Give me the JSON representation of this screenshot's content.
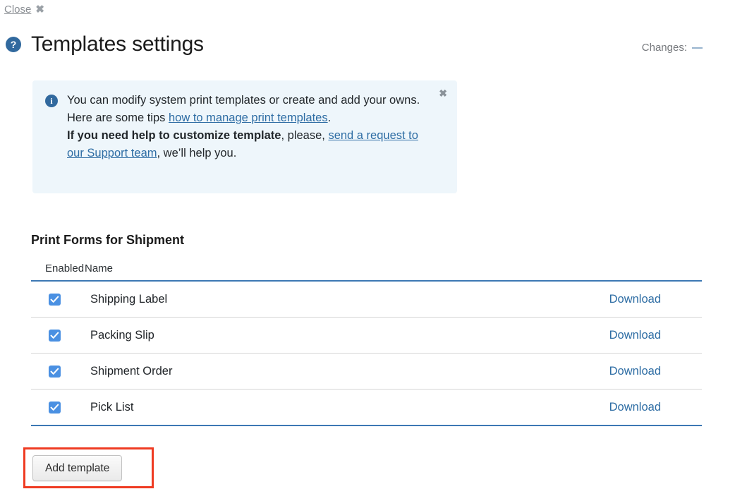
{
  "topbar": {
    "close_label": "Close",
    "close_icon_glyph": "✖"
  },
  "header": {
    "help_icon_glyph": "?",
    "title": "Templates settings",
    "changes_label": "Changes:",
    "changes_value": "—",
    "changes_value_color": "#31699e"
  },
  "notice": {
    "info_icon_glyph": "i",
    "close_icon_glyph": "✖",
    "line1_pre": "You can modify system print templates or create and add your owns. Here are some tips ",
    "link1": "how to manage print templates",
    "line1_post": ".",
    "line2_bold": "If you need help to customize template",
    "line2_mid": ", please, ",
    "link2": "send a request to our Support team",
    "line2_post": ", we’ll help you.",
    "background_color": "#eef6fb",
    "link_color": "#2e6da4"
  },
  "section": {
    "title": "Print Forms for Shipment"
  },
  "table": {
    "columns": [
      "Enabled",
      "Name",
      ""
    ],
    "border_color": "#3c78b4",
    "checkbox_color": "#4a90e2",
    "rows": [
      {
        "enabled": true,
        "name": "Shipping Label",
        "action": "Download"
      },
      {
        "enabled": true,
        "name": "Packing Slip",
        "action": "Download"
      },
      {
        "enabled": true,
        "name": "Shipment Order",
        "action": "Download"
      },
      {
        "enabled": true,
        "name": "Pick List",
        "action": "Download"
      }
    ]
  },
  "footer": {
    "add_template_label": "Add template",
    "highlight_color": "#ef3b22"
  }
}
